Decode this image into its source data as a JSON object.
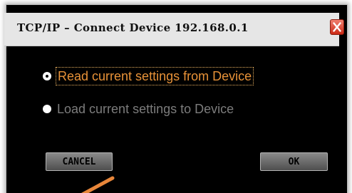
{
  "dialog": {
    "title": "TCP/IP – Connect Device 192.168.0.1",
    "close_icon": "close-icon"
  },
  "options": [
    {
      "label": "Read current settings from Device",
      "selected": true
    },
    {
      "label": "Load current settings to Device",
      "selected": false
    }
  ],
  "buttons": {
    "cancel_label": "CANCEL",
    "ok_label": "OK"
  },
  "colors": {
    "selected_text": "#e89238",
    "disabled_text": "#7c7c7c",
    "close_button": "#cc2a16"
  }
}
